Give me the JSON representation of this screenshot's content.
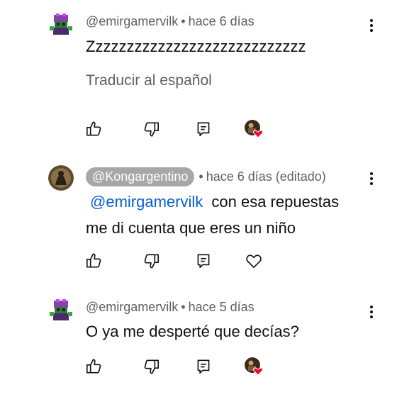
{
  "comments": [
    {
      "author": "@emirgamervilk",
      "time": "hace 6 días",
      "text": "Zzzzzzzzzzzzzzzzzzzzzzzzzzzz",
      "translate_label": "Traducir al español"
    },
    {
      "author": "@Kongargentino",
      "time": "hace 6 días (editado)",
      "mention": "@emirgamervilk",
      "text_line1": "con esa repuestas",
      "text_line2": "me di cuenta que eres un niño"
    },
    {
      "author": "@emirgamervilk",
      "time": "hace 5 días",
      "text": "O ya me desperté que decías?"
    }
  ],
  "separator": "•",
  "colors": {
    "mention": "#065fd4",
    "secondary": "#606060",
    "pill": "#a7a7a7",
    "heart": "#ff0033"
  },
  "icons": [
    "like-icon",
    "dislike-icon",
    "reply-icon",
    "heart-icon",
    "more-vert-icon"
  ]
}
